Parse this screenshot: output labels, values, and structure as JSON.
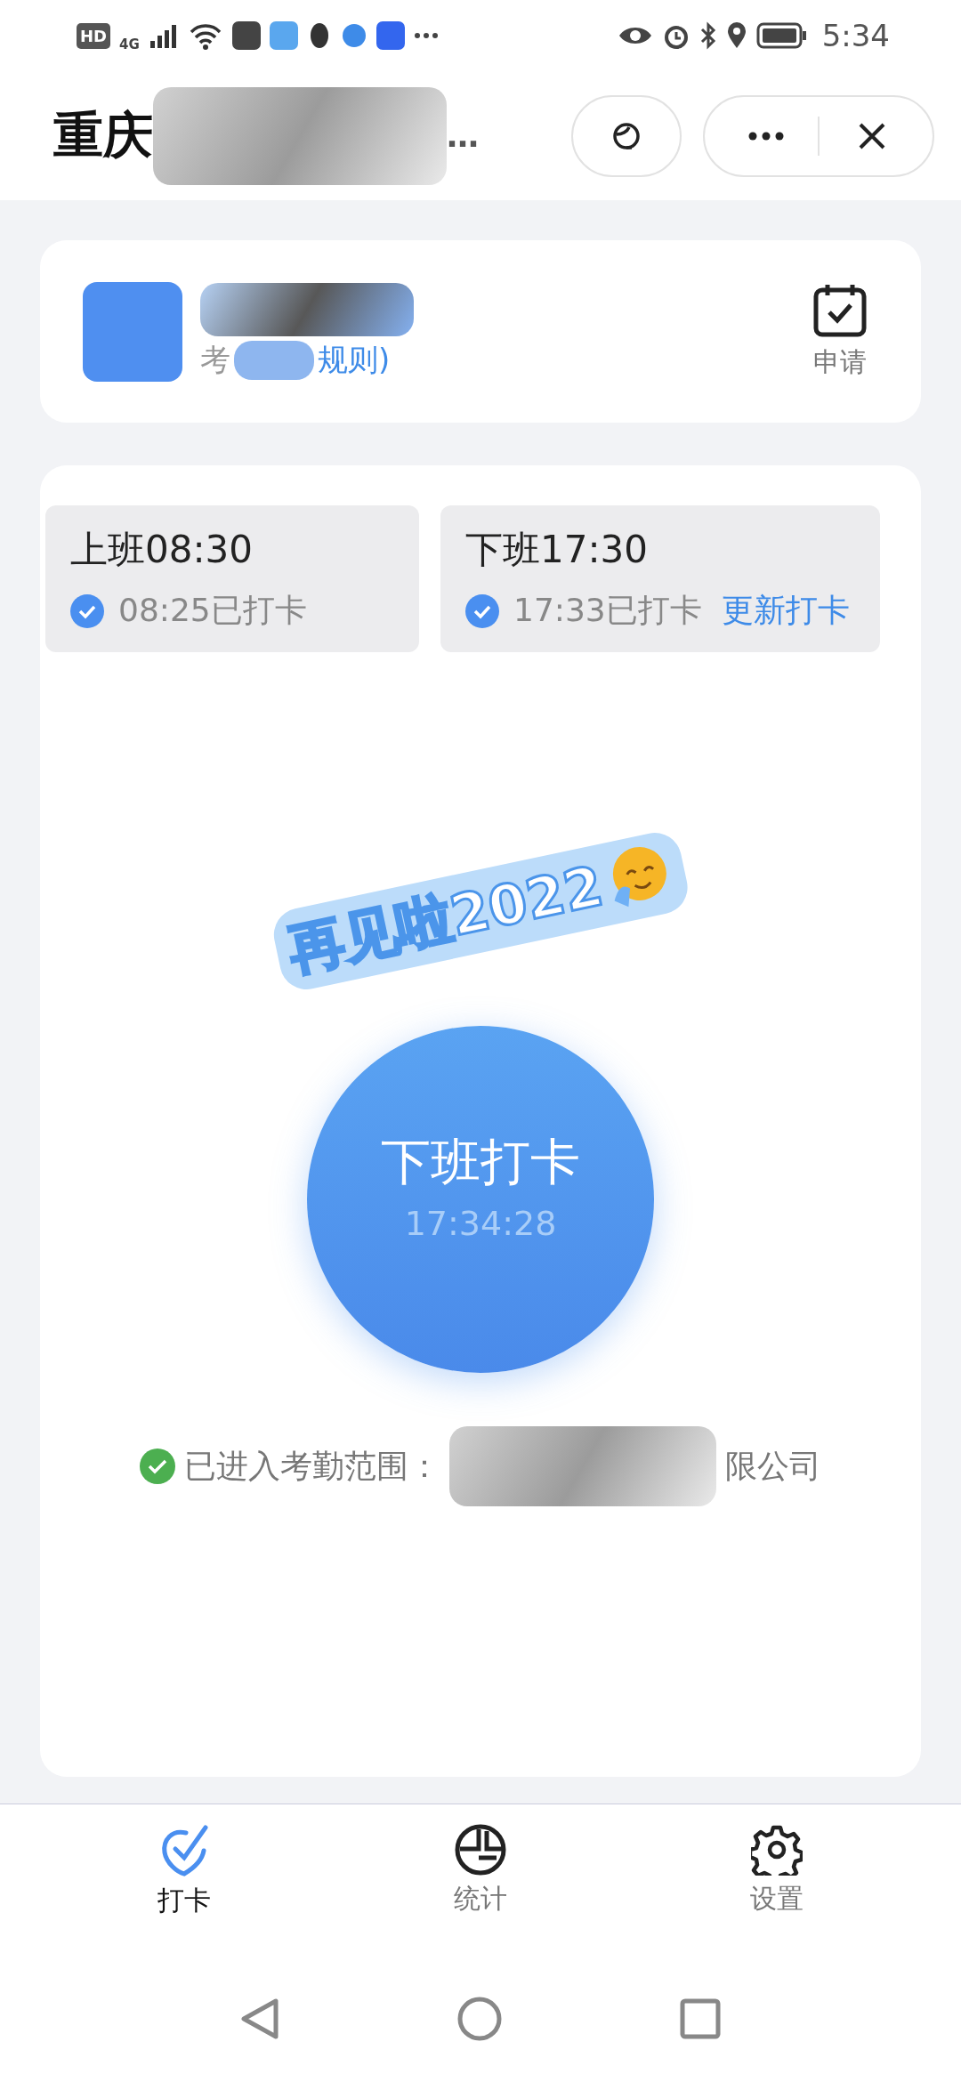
{
  "status_bar": {
    "hd": "HD",
    "network": "4G",
    "time": "5:34"
  },
  "header": {
    "title_start": "重庆",
    "title_end": "…"
  },
  "profile": {
    "subtitle_start": "考",
    "subtitle_end": "规则)",
    "action": "申请"
  },
  "punches": [
    {
      "title": "上班08:30",
      "status": "08:25已打卡",
      "done": true
    },
    {
      "title": "下班17:30",
      "status": "17:33已打卡",
      "done": true,
      "link": "更新打卡"
    }
  ],
  "clock_button": {
    "banner": "再见啦2022",
    "label": "下班打卡",
    "time": "17:34:28"
  },
  "location": {
    "prefix": "已进入考勤范围：",
    "suffix": "限公司",
    "inside": true
  },
  "tabs": [
    {
      "label": "打卡",
      "selected": true,
      "kind": "check"
    },
    {
      "label": "统计",
      "selected": false,
      "kind": "chart"
    },
    {
      "label": "设置",
      "selected": false,
      "kind": "gear"
    }
  ]
}
